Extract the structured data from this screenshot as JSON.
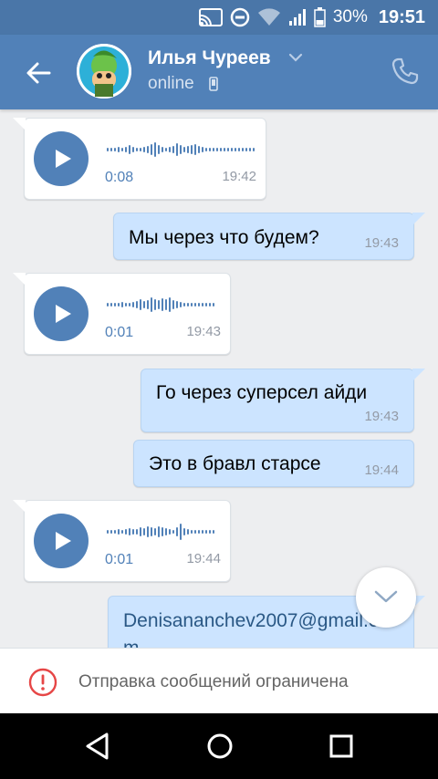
{
  "status_bar": {
    "battery_percent": "30%",
    "clock": "19:51"
  },
  "header": {
    "contact_name": "Илья Чуреев",
    "contact_status": "online"
  },
  "messages": [
    {
      "direction": "in",
      "type": "voice",
      "duration": "0:08",
      "time": "19:42"
    },
    {
      "direction": "out",
      "type": "text",
      "text": "Мы через что будем?",
      "time": "19:43"
    },
    {
      "direction": "in",
      "type": "voice",
      "duration": "0:01",
      "time": "19:43"
    },
    {
      "direction": "out",
      "type": "text",
      "text": "Го через суперсел айди",
      "time": "19:43"
    },
    {
      "direction": "out",
      "type": "text",
      "text": "Это в бравл старсе",
      "time": "19:44"
    },
    {
      "direction": "in",
      "type": "voice",
      "duration": "0:01",
      "time": "19:44"
    },
    {
      "direction": "out",
      "type": "text",
      "text": "Denisananchev2007@gmail.com"
    }
  ],
  "restriction_notice": "Отправка сообщений ограничена",
  "colors": {
    "accent": "#5181b8",
    "incoming_bubble": "#ffffff",
    "outgoing_bubble": "#cce4ff",
    "warning": "#e64646"
  },
  "icons": {
    "back": "arrow-left-icon",
    "call": "phone-icon",
    "play": "play-icon",
    "scroll_down": "chevron-down-icon",
    "warning": "exclamation-circle-icon",
    "nav_back": "triangle-back-icon",
    "nav_home": "circle-home-icon",
    "nav_recents": "square-recents-icon"
  }
}
